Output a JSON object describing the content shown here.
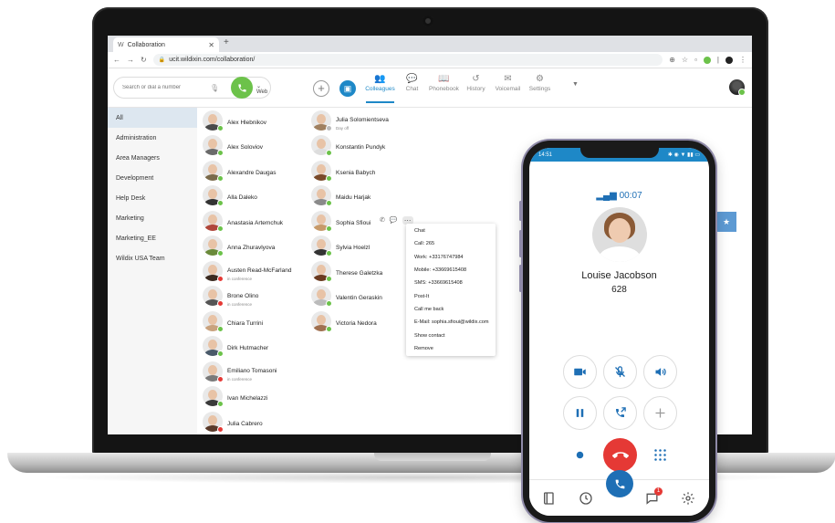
{
  "browser": {
    "tab_title": "Collaboration",
    "url": "ucit.wildixin.com/collaboration/"
  },
  "toolbar": {
    "search_placeholder": "Search or dial a number",
    "web_label": "Web",
    "nav_tabs": [
      {
        "label": "Colleagues",
        "icon": "people-icon"
      },
      {
        "label": "Chat",
        "icon": "chat-icon"
      },
      {
        "label": "Phonebook",
        "icon": "phonebook-icon"
      },
      {
        "label": "History",
        "icon": "history-icon"
      },
      {
        "label": "Voicemail",
        "icon": "voicemail-icon"
      },
      {
        "label": "Settings",
        "icon": "settings-icon"
      }
    ],
    "active_tab": "Colleagues"
  },
  "groups": [
    "All",
    "Administration",
    "Area Managers",
    "Development",
    "Help Desk",
    "Marketing",
    "Marketing_EE",
    "Wildix USA Team"
  ],
  "active_group": "All",
  "colleagues_col1": [
    {
      "name": "Alex Hlebnikov",
      "note": "",
      "status": "online",
      "tone": "#4a4a4a"
    },
    {
      "name": "Alex Soloviov",
      "note": "",
      "status": "online",
      "tone": "#6a6a6a"
    },
    {
      "name": "Alexandre Daugas",
      "note": "",
      "status": "online",
      "tone": "#7a6a4a"
    },
    {
      "name": "Alla Daleko",
      "note": "",
      "status": "online",
      "tone": "#333333"
    },
    {
      "name": "Anastasia Artemchuk",
      "note": "",
      "status": "online",
      "tone": "#b0463a"
    },
    {
      "name": "Anna Zhuravlyova",
      "note": "",
      "status": "online",
      "tone": "#6a8a3a"
    },
    {
      "name": "Austen Read-McFarland",
      "note": "in conference",
      "status": "busy",
      "tone": "#3a2a20"
    },
    {
      "name": "Brone Olino",
      "note": "in conference",
      "status": "busy",
      "tone": "#555555"
    },
    {
      "name": "Chiara Turrini",
      "note": "",
      "status": "online",
      "tone": "#c9a27e"
    },
    {
      "name": "Dirk Hutmacher",
      "note": "",
      "status": "online",
      "tone": "#4a5a6a"
    },
    {
      "name": "Emiliano Tomasoni",
      "note": "in conference",
      "status": "busy",
      "tone": "#7a7a7a"
    },
    {
      "name": "Ivan Michelazzi",
      "note": "",
      "status": "online",
      "tone": "#3a3a3a"
    },
    {
      "name": "Julia Cabrero",
      "note": "",
      "status": "busy",
      "tone": "#5a3a2a"
    }
  ],
  "colleagues_col2": [
    {
      "name": "Julia Solomientseva",
      "note": "Day off",
      "status": "away",
      "tone": "#a08060"
    },
    {
      "name": "Konstantin Pundyk",
      "note": "",
      "status": "online",
      "tone": "#dddddd"
    },
    {
      "name": "Ksenia Babych",
      "note": "",
      "status": "online",
      "tone": "#7a4a2a"
    },
    {
      "name": "Maidu Harjak",
      "note": "",
      "status": "online",
      "tone": "#8a8a8a"
    },
    {
      "name": "Sophia Sfioui",
      "note": "",
      "status": "online",
      "tone": "#c79a6a"
    },
    {
      "name": "Sylvia Hoelzl",
      "note": "",
      "status": "online",
      "tone": "#333333"
    },
    {
      "name": "Therese Galetzka",
      "note": "",
      "status": "online",
      "tone": "#6a3a20"
    },
    {
      "name": "Valentin Geraskin",
      "note": "",
      "status": "online",
      "tone": "#bbbbbb"
    },
    {
      "name": "Victoria Nedora",
      "note": "",
      "status": "online",
      "tone": "#a07050"
    }
  ],
  "context_menu": [
    "Chat",
    "Call: 265",
    "Work: +33176747984",
    "Mobile: +33669615408",
    "SMS: +33669615408",
    "Post-It",
    "Call me back",
    "E-Mail: sophia.sfioui@wildix.com",
    "Show contact",
    "Remove"
  ],
  "phone": {
    "time": "14:51",
    "call_timer": "00:07",
    "caller_name": "Louise Jacobson",
    "caller_ext": "628",
    "chat_badge": "1"
  },
  "colors": {
    "accent": "#1e88c7",
    "online": "#6cc24a",
    "busy": "#e53935",
    "hangup": "#e53935"
  }
}
